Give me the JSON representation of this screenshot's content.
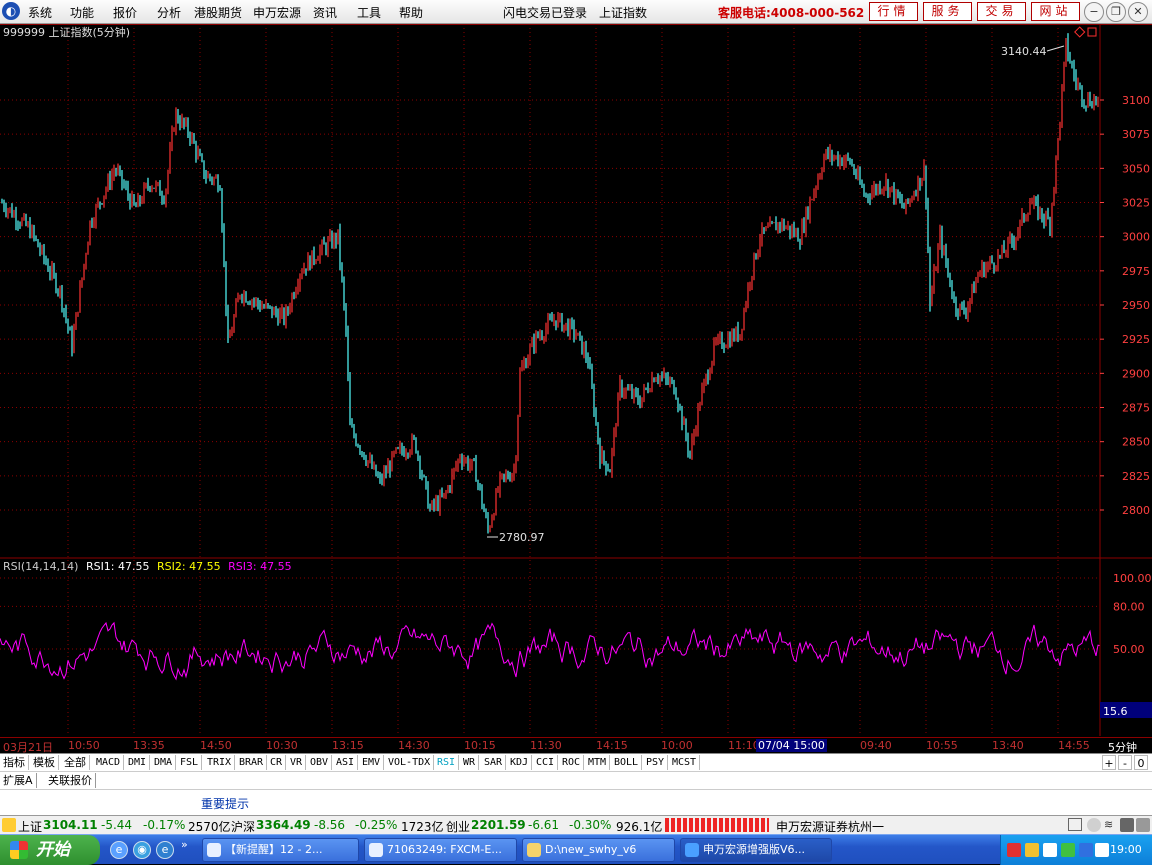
{
  "menubar": {
    "items": [
      "系统",
      "功能",
      "报价",
      "分析",
      "港股期货",
      "申万宏源",
      "资讯",
      "工具",
      "帮助"
    ],
    "login_status": "闪电交易已登录",
    "current_name": "上证指数",
    "hotline": "客服电话:4008-000-562",
    "buttons": [
      "行情",
      "服务",
      "交易",
      "网站"
    ]
  },
  "chart": {
    "title": "999999 上证指数(5分钟)",
    "max_label": "3140.44",
    "min_label": "2780.97",
    "price_axis": [
      "3100",
      "3075",
      "3050",
      "3025",
      "3000",
      "2975",
      "2950",
      "2925",
      "2900",
      "2875",
      "2850",
      "2825",
      "2800"
    ],
    "rsi_header": "RSI(14,14,14)",
    "rsi1": "RSI1: 47.55",
    "rsi2": "RSI2: 47.55",
    "rsi3": "RSI3: 47.55",
    "rsi_axis": [
      "100.00",
      "80.00",
      "50.00"
    ],
    "rsi_readout": "15.6",
    "colors": {
      "up": "#ff3232",
      "down": "#54ffff",
      "rsi": "#ff00ff",
      "grid": "#8b0000"
    }
  },
  "chart_data": {
    "type": "line",
    "series": [
      {
        "name": "RSI1",
        "values": [
          47.55
        ]
      }
    ],
    "price_range": [
      2780.97,
      3140.44
    ],
    "ylim": [
      2790,
      3135
    ],
    "rsi_ylim": [
      0,
      100
    ]
  },
  "xaxis": {
    "labels": [
      "03月21日",
      "10:50",
      "13:35",
      "14:50",
      "10:30",
      "13:15",
      "14:30",
      "10:15",
      "11:30",
      "14:15",
      "10:00",
      "11:10",
      "09:40",
      "10:55",
      "13:40",
      "14:55"
    ],
    "cursor_time": "07/04 15:00",
    "period": "5分钟"
  },
  "tabs": {
    "items": [
      "指标",
      "模板",
      "全部",
      "MACD",
      "DMI",
      "DMA",
      "FSL",
      "TRIX",
      "BRAR",
      "CR",
      "VR",
      "OBV",
      "ASI",
      "EMV",
      "VOL-TDX",
      "RSI",
      "WR",
      "SAR",
      "KDJ",
      "CCI",
      "ROC",
      "MTM",
      "BOLL",
      "PSY",
      "MCST"
    ],
    "controls": [
      "+",
      "-",
      "0"
    ]
  },
  "subtabs": [
    "扩展A",
    "关联报价"
  ],
  "notice": "重要提示",
  "ticker": {
    "sh_name": "上证",
    "sh_price": "3104.11",
    "sh_chg": "-5.44",
    "sh_pct": "-0.17%",
    "sh_amt": "2570亿",
    "hs_name": "沪深",
    "hs_price": "3364.49",
    "hs_chg": "-8.56",
    "hs_pct": "-0.25%",
    "hs_amt": "1723亿",
    "cy_name": "创业",
    "cy_price": "2201.59",
    "cy_chg": "-6.61",
    "cy_pct": "-0.30%",
    "cy_amt": "926.1亿",
    "broker": "申万宏源证券杭州一"
  },
  "taskbar": {
    "start": "开始",
    "tasks": [
      "【新提醒】12 - 2...",
      "71063249: FXCM-E...",
      "D:\\new_swhy_v6",
      "申万宏源增强版V6..."
    ],
    "clock": "19:00"
  }
}
